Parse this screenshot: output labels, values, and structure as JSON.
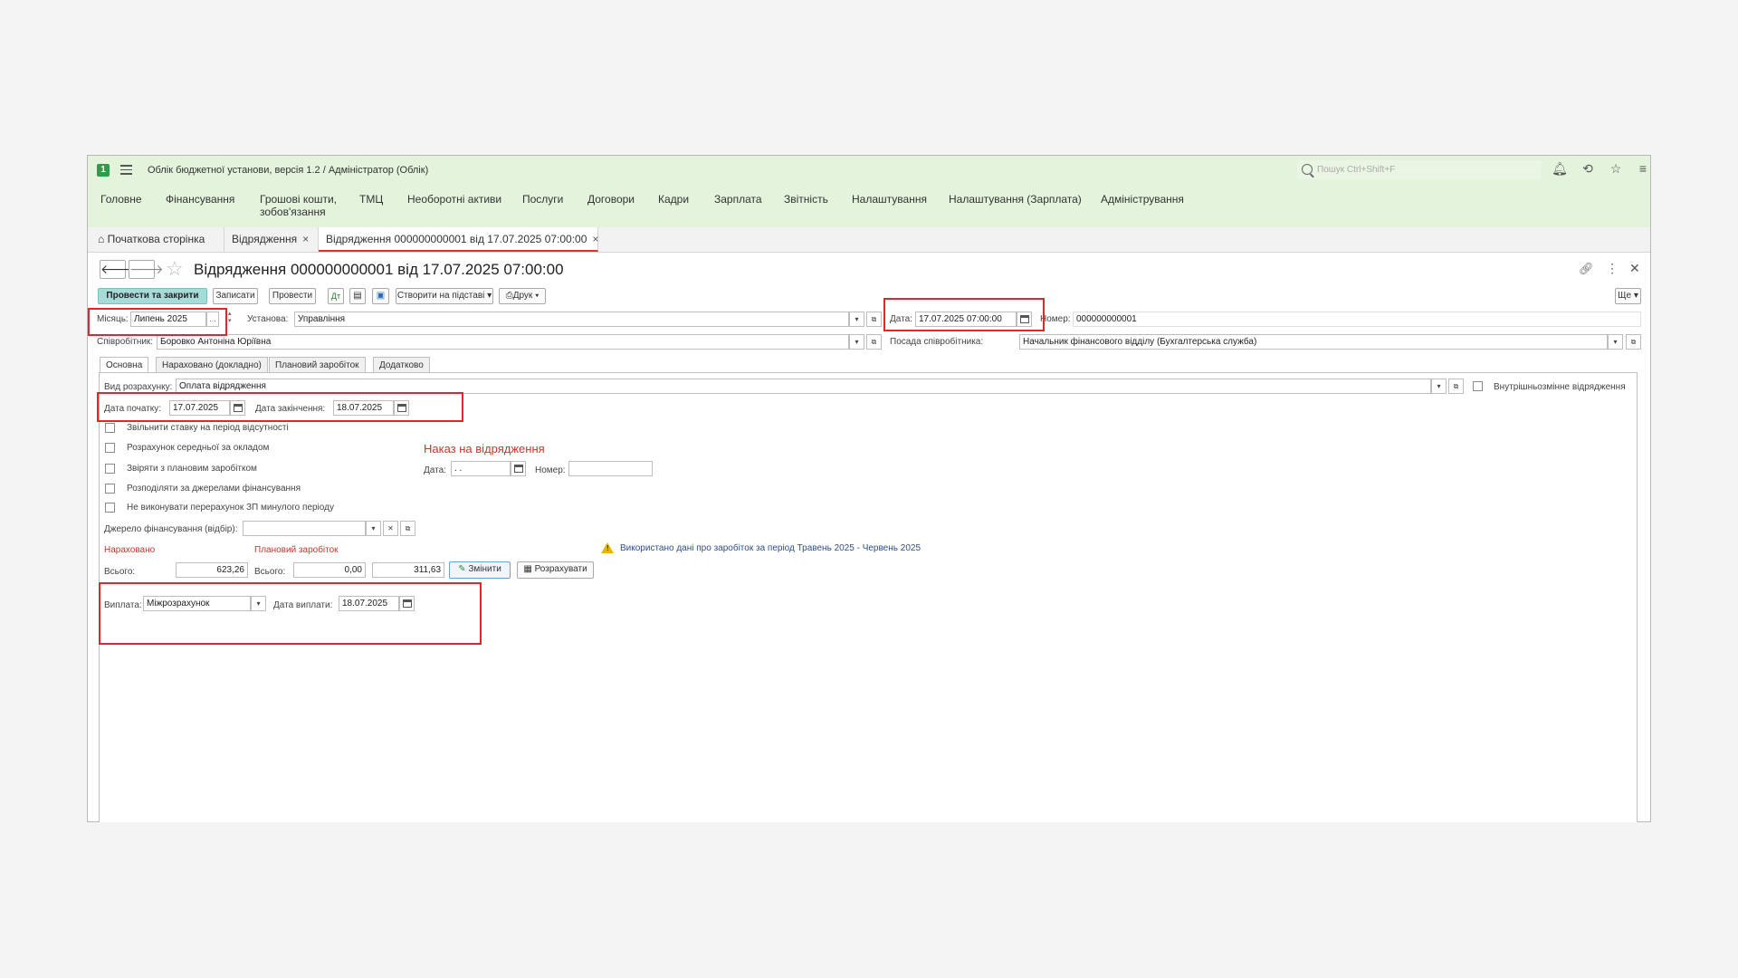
{
  "app": {
    "title": "Облік бюджетної установи, версія 1.2 / Адміністратор  (Облік)",
    "logo_text": "1",
    "search_placeholder": "Пошук Ctrl+Shift+F"
  },
  "menu": {
    "items": [
      "Головне",
      "Фінансування",
      "Грошові кошти,",
      "зобов'язання",
      "ТМЦ",
      "Необоротні активи",
      "Послуги",
      "Договори",
      "Кадри",
      "Зарплата",
      "Звітність",
      "Налаштування",
      "Налаштування (Зарплата)",
      "Адміністрування"
    ]
  },
  "tabs": {
    "home": "Початкова сторінка",
    "list": "Відрядження",
    "doc": "Відрядження 000000000001 від 17.07.2025 07:00:00",
    "close": "×"
  },
  "document": {
    "title": "Відрядження 000000000001 від 17.07.2025 07:00:00",
    "more_label": "..."
  },
  "toolbar": {
    "post_close": "Провести та закрити",
    "save": "Записати",
    "post": "Провести",
    "create_based": "Створити на підставі",
    "print": "Друк",
    "more": "Ще"
  },
  "header": {
    "month_label": "Місяць:",
    "month_value": "Липень 2025",
    "org_label": "Установа:",
    "org_value": "Управління",
    "date_label": "Дата:",
    "date_value": "17.07.2025 07:00:00",
    "number_label": "Номер:",
    "number_value": "000000000001",
    "employee_label": "Співробітник:",
    "employee_value": "Боровко Антоніна Юріївна",
    "position_label": "Посада співробітника:",
    "position_value": "Начальник фінансового відділу (Бухгалтерська служба)"
  },
  "form_tabs": [
    "Основна",
    "Нараховано (докладно)",
    "Плановий заробіток",
    "Додатково"
  ],
  "main": {
    "calc_type_label": "Вид розрахунку:",
    "calc_type_value": "Оплата відрядження",
    "internal_label": "Внутрішньозмінне відрядження",
    "start_label": "Дата початку:",
    "start_value": "17.07.2025",
    "end_label": "Дата закінчення:",
    "end_value": "18.07.2025",
    "checkboxes": [
      "Звільнити ставку на період відсутності",
      "Розрахунок середньої за окладом",
      "Звіряти з плановим заробітком",
      "Розподіляти за джерелами фінансування",
      "Не виконувати перерахунок ЗП минулого періоду"
    ],
    "order_title": "Наказ на відрядження",
    "order_date_label": "Дата:",
    "order_date_value": " .  .",
    "order_number_label": "Номер:",
    "funding_label": "Джерело фінансування (відбір):",
    "accrued_title": "Нараховано",
    "planned_title": "Плановий заробіток",
    "total_label": "Всього:",
    "accrued_total": "623,26",
    "planned_total": "0,00",
    "planned_extra": "311,63",
    "change_button": "Змінити",
    "calc_button": "Розрахувати",
    "warning_text": "Використано дані про заробіток за період Травень 2025 - Червень 2025",
    "payment_label": "Виплата:",
    "payment_value": "Міжрозрахунок",
    "payment_date_label": "Дата виплати:",
    "payment_date_value": "18.07.2025"
  },
  "colors": {
    "accent_green": "#e3f3dc",
    "highlight_red": "#e3262b",
    "primary_button": "#a7dbd9"
  }
}
